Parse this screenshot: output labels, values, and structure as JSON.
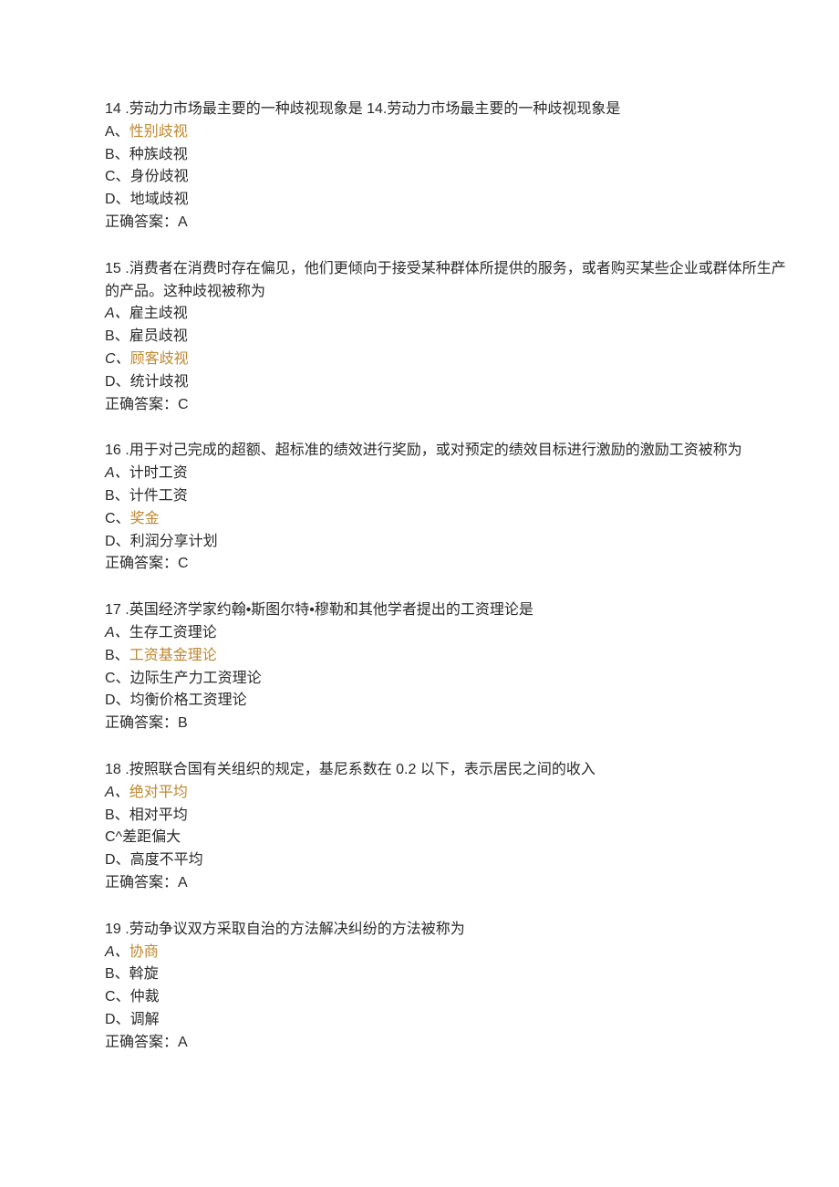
{
  "questions": [
    {
      "number": "14",
      "sep": "   .",
      "text": "劳动力市场最主要的一种歧视现象是 14.劳动力市场最主要的一种歧视现象是",
      "options": [
        {
          "letter": "A、",
          "text": "性别歧视",
          "letterClass": "",
          "hClass": "highlight"
        },
        {
          "letter": "B、",
          "text": "种族歧视",
          "letterClass": "",
          "hClass": ""
        },
        {
          "letter": "C、",
          "text": "身份歧视",
          "letterClass": "",
          "hClass": ""
        },
        {
          "letter": "D、",
          "text": "地域歧视",
          "letterClass": "",
          "hClass": ""
        }
      ],
      "answerLabel": "正确答案：",
      "answerVal": "A"
    },
    {
      "number": "15",
      "sep": "   .",
      "text": "消费者在消费时存在偏见，他们更倾向于接受某种群体所提供的服务，或者购买某些企业或群体所生产的产品。这种歧视被称为",
      "options": [
        {
          "letter": "A、",
          "text": "雇主歧视",
          "letterClass": "italic-a",
          "hClass": ""
        },
        {
          "letter": "B、",
          "text": "雇员歧视",
          "letterClass": "",
          "hClass": ""
        },
        {
          "letter": "C、",
          "text": "顾客歧视",
          "letterClass": "italic-a",
          "hClass": "highlight"
        },
        {
          "letter": "D、",
          "text": "统计歧视",
          "letterClass": "",
          "hClass": ""
        }
      ],
      "answerLabel": "正确答案：",
      "answerVal": "C"
    },
    {
      "number": "16",
      "sep": "   .",
      "text": "用于对己完成的超额、超标准的绩效进行奖励，或对预定的绩效目标进行激励的激励工资被称为",
      "options": [
        {
          "letter": "A、",
          "text": "计时工资",
          "letterClass": "italic-a",
          "hClass": ""
        },
        {
          "letter": "B、",
          "text": "计件工资",
          "letterClass": "",
          "hClass": ""
        },
        {
          "letter": "C、",
          "text": "奖金",
          "letterClass": "",
          "hClass": "highlight"
        },
        {
          "letter": "D、",
          "text": "利润分享计划",
          "letterClass": "",
          "hClass": ""
        }
      ],
      "answerLabel": "正确答案：",
      "answerVal": "C"
    },
    {
      "number": "17",
      "sep": "   .",
      "text": "英国经济学家约翰•斯图尔特•穆勒和其他学者提出的工资理论是",
      "options": [
        {
          "letter": "A、",
          "text": "生存工资理论",
          "letterClass": "italic-a",
          "hClass": ""
        },
        {
          "letter": "B、",
          "text": "工资基金理论",
          "letterClass": "",
          "hClass": "highlight"
        },
        {
          "letter": "C、",
          "text": "边际生产力工资理论",
          "letterClass": "",
          "hClass": ""
        },
        {
          "letter": "D、",
          "text": "均衡价格工资理论",
          "letterClass": "",
          "hClass": ""
        }
      ],
      "answerLabel": "正确答案：",
      "answerVal": "B"
    },
    {
      "number": "18",
      "sep": "   .",
      "text": "按照联合国有关组织的规定，基尼系数在 0.2 以下，表示居民之间的收入",
      "options": [
        {
          "letter": "A、",
          "text": "绝对平均",
          "letterClass": "italic-a",
          "hClass": "highlight"
        },
        {
          "letter": "B、",
          "text": "相对平均",
          "letterClass": "",
          "hClass": ""
        },
        {
          "letter": "C^",
          "text": "差距偏大",
          "letterClass": "",
          "hClass": ""
        },
        {
          "letter": "D、",
          "text": "高度不平均",
          "letterClass": "",
          "hClass": ""
        }
      ],
      "answerLabel": "正确答案：",
      "answerVal": "A"
    },
    {
      "number": "19",
      "sep": "   .",
      "text": "劳动争议双方采取自治的方法解决纠纷的方法被称为",
      "options": [
        {
          "letter": "A、",
          "text": "协商",
          "letterClass": "italic-a",
          "hClass": "highlight"
        },
        {
          "letter": "B、",
          "text": "斡旋",
          "letterClass": "",
          "hClass": ""
        },
        {
          "letter": "C、",
          "text": "仲裁",
          "letterClass": "",
          "hClass": ""
        },
        {
          "letter": "D、",
          "text": "调解",
          "letterClass": "",
          "hClass": ""
        }
      ],
      "answerLabel": "正确答案：",
      "answerVal": "A"
    }
  ]
}
